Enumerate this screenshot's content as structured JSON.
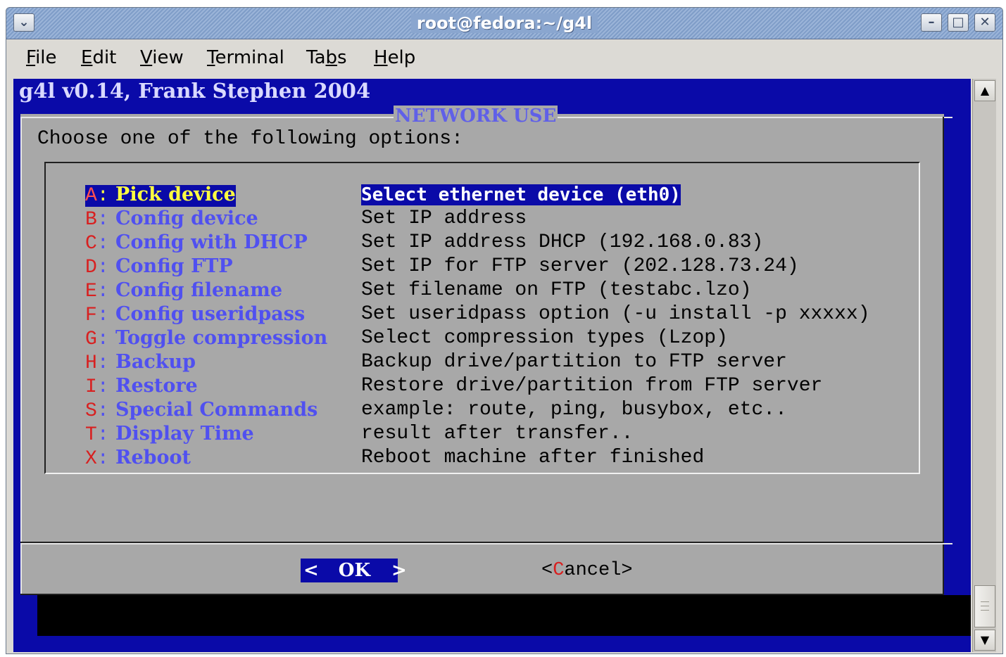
{
  "window": {
    "title": "root@fedora:~/g4l",
    "menu_icon": "chevron-down-icon",
    "min_icon": "minimize-icon",
    "max_icon": "maximize-icon",
    "close_icon": "close-icon",
    "min_glyph": "–",
    "max_glyph": "□",
    "close_glyph": "✕",
    "menu_glyph": "⌄"
  },
  "menubar": {
    "items": [
      {
        "pre": "",
        "ul": "F",
        "post": "ile"
      },
      {
        "pre": "",
        "ul": "E",
        "post": "dit"
      },
      {
        "pre": "",
        "ul": "V",
        "post": "iew"
      },
      {
        "pre": "",
        "ul": "T",
        "post": "erminal"
      },
      {
        "pre": "Ta",
        "ul": "b",
        "post": "s"
      },
      {
        "pre": "",
        "ul": "H",
        "post": "elp"
      }
    ]
  },
  "terminal": {
    "header": "g4l v0.14, Frank Stephen 2004",
    "dialog_title": "NETWORK USE",
    "prompt": "Choose one of the following options:",
    "options": [
      {
        "key": "A",
        "sep": ":",
        "name": " Pick device",
        "desc": "Select ethernet device (eth0)"
      },
      {
        "key": "B",
        "sep": ":",
        "name": " Config device",
        "desc": "Set IP address"
      },
      {
        "key": "C",
        "sep": ":",
        "name": " Config with DHCP",
        "desc": "Set IP address DHCP (192.168.0.83)"
      },
      {
        "key": "D",
        "sep": ":",
        "name": " Config FTP",
        "desc": "Set IP for FTP server (202.128.73.24)"
      },
      {
        "key": "E",
        "sep": ":",
        "name": " Config filename",
        "desc": "Set filename on FTP (testabc.lzo)"
      },
      {
        "key": "F",
        "sep": ":",
        "name": " Config useridpass",
        "desc": "Set useridpass option (-u install -p xxxxx)"
      },
      {
        "key": "G",
        "sep": ":",
        "name": " Toggle compression",
        "desc": "Select compression types (Lzop)"
      },
      {
        "key": "H",
        "sep": ":",
        "name": " Backup",
        "desc": "Backup drive/partition to FTP server"
      },
      {
        "key": "I",
        "sep": ":",
        "name": " Restore",
        "desc": "Restore drive/partition from FTP server"
      },
      {
        "key": "S",
        "sep": ":",
        "name": " Special Commands",
        "desc": "example: route, ping, busybox, etc.."
      },
      {
        "key": "T",
        "sep": ":",
        "name": " Display Time",
        "desc": "result after transfer.."
      },
      {
        "key": "X",
        "sep": ":",
        "name": " Reboot",
        "desc": "Reboot machine after finished"
      }
    ],
    "ok_button": {
      "left": "<",
      "label": "OK",
      "right": ">"
    },
    "cancel_button": {
      "left": "<",
      "first": "C",
      "rest": "ancel",
      "right": ">"
    }
  },
  "scrollbar": {
    "up_icon": "scroll-up-arrow-icon",
    "down_icon": "scroll-down-arrow-icon",
    "up_glyph": "▲",
    "down_glyph": "▼"
  },
  "colors": {
    "terminal_bg": "#0a0aa8",
    "dialog_bg": "#a8a8a8",
    "hotkey": "#d82020",
    "option_name": "#5050f0",
    "selected_text": "#ffff40"
  }
}
